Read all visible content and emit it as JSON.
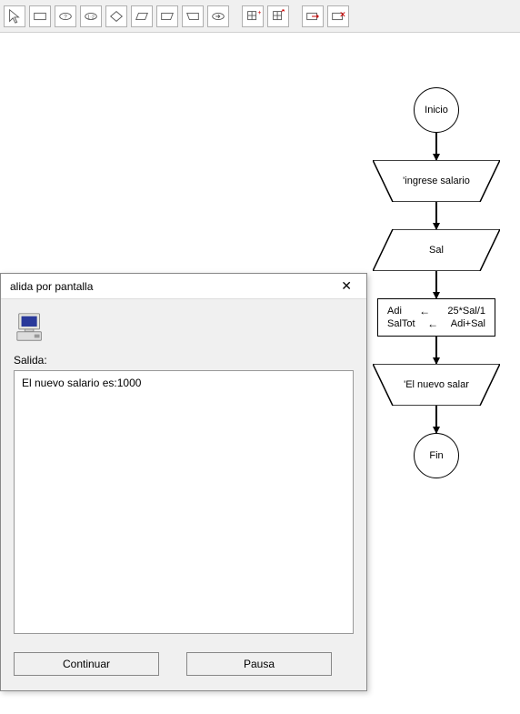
{
  "toolbar": {
    "buttons": [
      {
        "name": "cursor-icon"
      },
      {
        "name": "rect-icon"
      },
      {
        "name": "ellipse-input-icon"
      },
      {
        "name": "ellipse-n-icon"
      },
      {
        "name": "diamond-icon"
      },
      {
        "name": "parallelogram-icon"
      },
      {
        "name": "trapezoid-left-icon"
      },
      {
        "name": "trapezoid-right-icon"
      },
      {
        "name": "ellipse-return-icon"
      },
      {
        "sep": true
      },
      {
        "name": "grid-plus-icon"
      },
      {
        "name": "grid-arrow-icon"
      },
      {
        "sep": true
      },
      {
        "name": "rect-arrow-icon"
      },
      {
        "name": "rect-cross-icon"
      }
    ]
  },
  "flowchart": {
    "start": "Inicio",
    "input": "'ingrese salario",
    "read": "Sal",
    "process": {
      "rows": [
        {
          "var": "Adi",
          "expr": "25*Sal/1"
        },
        {
          "var": "SalTot",
          "expr": "Adi+Sal"
        }
      ]
    },
    "output": "'El nuevo salar",
    "end": "Fin"
  },
  "dialog": {
    "title": "alida por pantalla",
    "label": "Salida:",
    "content": "El nuevo salario es:1000",
    "btn_continue": "Continuar",
    "btn_pause": "Pausa"
  }
}
